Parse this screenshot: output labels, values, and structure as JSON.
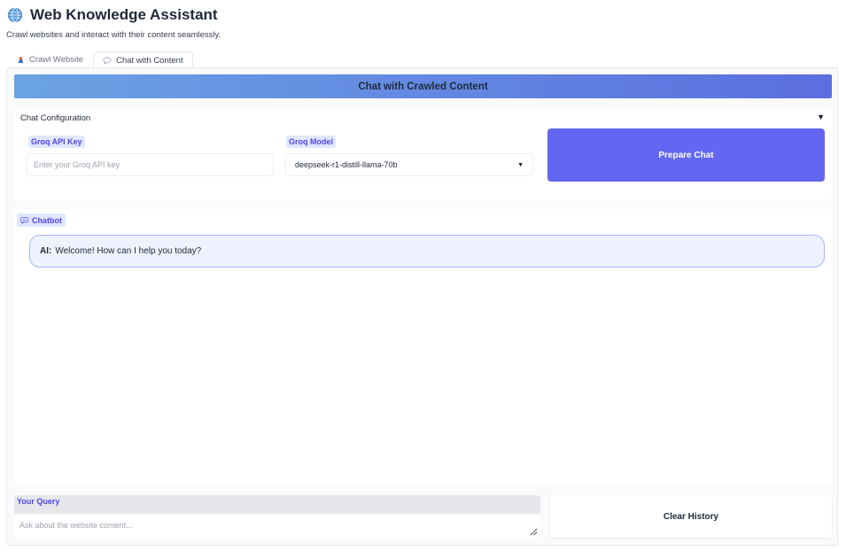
{
  "header": {
    "icon": "globe-icon",
    "title": "Web Knowledge Assistant",
    "subtitle": "Crawl websites and interact with their content seamlessly."
  },
  "tabs": [
    {
      "label": "Crawl Website",
      "icon": "spider-icon",
      "active": false
    },
    {
      "label": "Chat with Content",
      "icon": "speech-bubble-icon",
      "active": true
    }
  ],
  "banner": {
    "title": "Chat with Crawled Content"
  },
  "config": {
    "title": "Chat Configuration",
    "toggle_glyph": "▼",
    "api_key": {
      "label": "Groq API Key",
      "value": "",
      "placeholder": "Enter your Groq API key"
    },
    "model": {
      "label": "Groq Model",
      "value": "deepseek-r1-distill-llama-70b"
    },
    "prepare_label": "Prepare Chat"
  },
  "chatbot": {
    "label": "Chatbot",
    "messages": [
      {
        "speaker": "AI:",
        "text": "Welcome! How can I help you today?"
      }
    ]
  },
  "query": {
    "label": "Your Query",
    "value": "",
    "placeholder": "Ask about the website content..."
  },
  "clear_label": "Clear History",
  "colors": {
    "accent": "#6366f1",
    "label_bg": "#e0e7ff",
    "label_text": "#4f46e5",
    "message_bg": "#eef2ff"
  }
}
